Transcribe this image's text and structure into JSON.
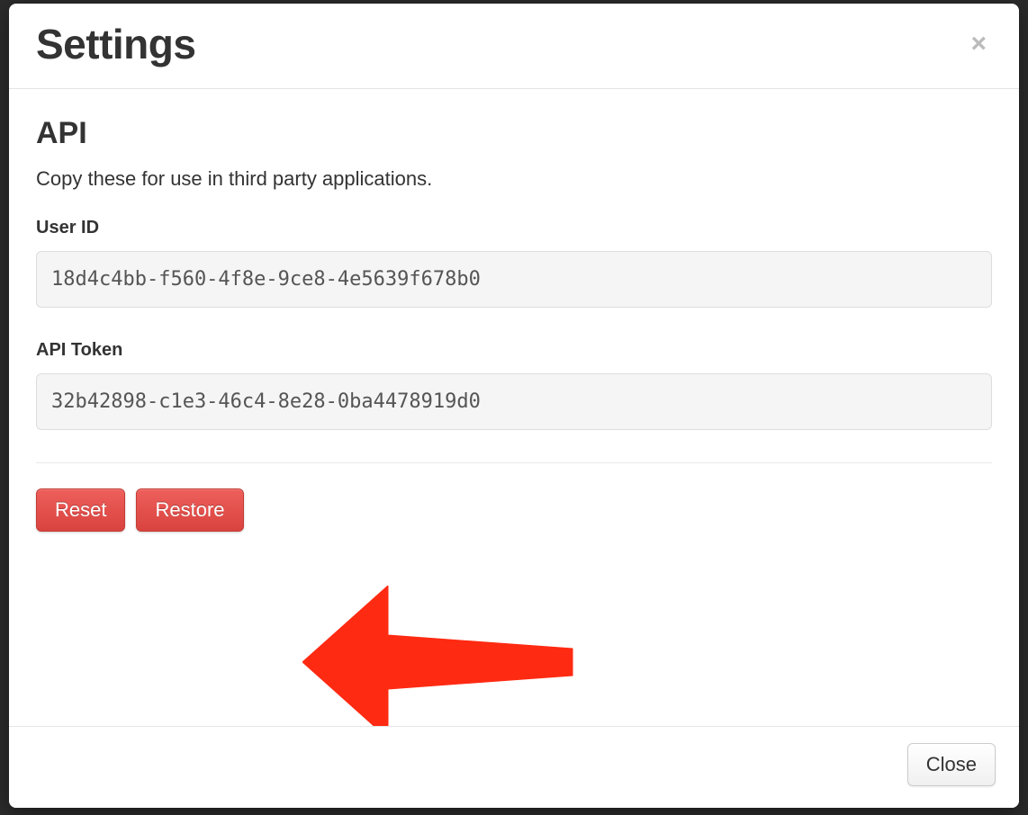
{
  "modal": {
    "title": "Settings",
    "close_glyph": "×"
  },
  "api": {
    "heading": "API",
    "description": "Copy these for use in third party applications.",
    "user_id_label": "User ID",
    "user_id_value": "18d4c4bb-f560-4f8e-9ce8-4e5639f678b0",
    "api_token_label": "API Token",
    "api_token_value": "32b42898-c1e3-46c4-8e28-0ba4478919d0",
    "reset_label": "Reset",
    "restore_label": "Restore"
  },
  "footer": {
    "close_label": "Close"
  }
}
